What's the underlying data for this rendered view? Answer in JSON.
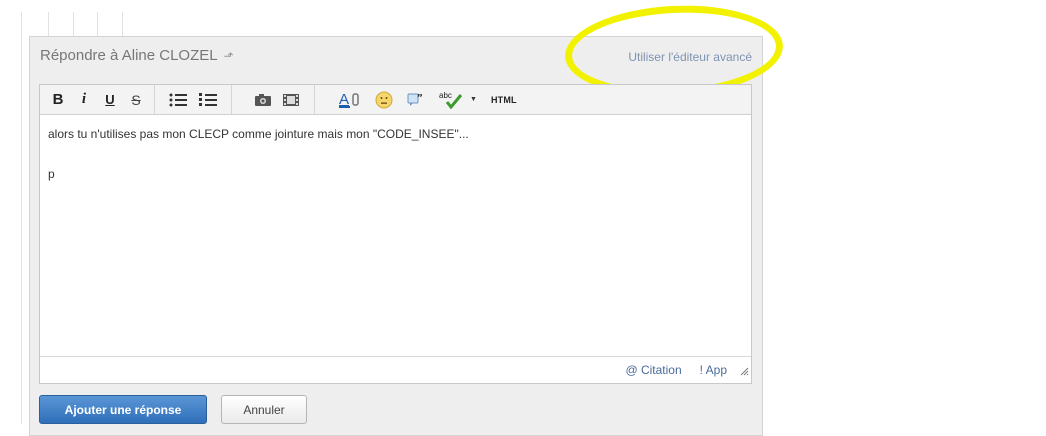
{
  "reply_header": {
    "title": "Répondre à Aline CLOZEL",
    "advanced_editor_link": "Utiliser l'éditeur avancé"
  },
  "toolbar": {
    "bold": "B",
    "italic": "i",
    "underline": "U",
    "strikethrough": "S",
    "html": "HTML",
    "spellcheck_label": "abc"
  },
  "editor": {
    "lines": [
      "alors tu n'utilises pas mon CLECP comme jointure mais mon \"CODE_INSEE\"...",
      "p"
    ]
  },
  "footer_links": {
    "citation": "@ Citation",
    "app": "! App"
  },
  "buttons": {
    "submit": "Ajouter une réponse",
    "cancel": "Annuler"
  },
  "colors": {
    "highlight": "#f2f200",
    "primary_button": "#3a7cc6",
    "link": "#7f93b3"
  }
}
